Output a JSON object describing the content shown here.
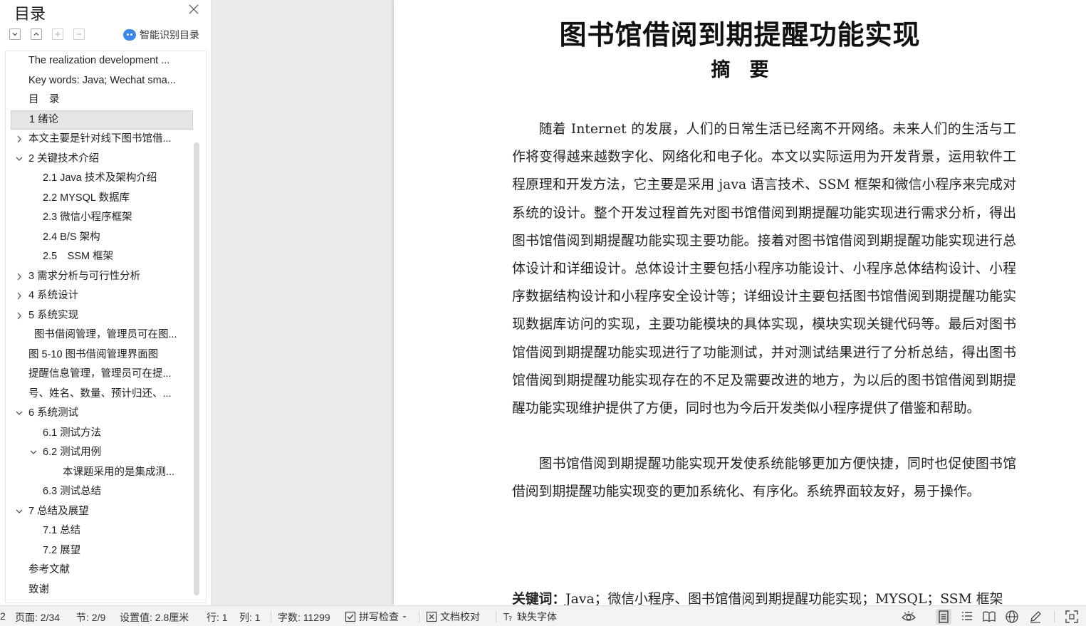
{
  "sidebar": {
    "title": "目录",
    "smart_toc_label": "智能识别目录",
    "items": [
      {
        "label": "The realization development ...",
        "level": 1,
        "chevron": "none"
      },
      {
        "label": "Key words: Java; Wechat sma...",
        "level": 1,
        "chevron": "none"
      },
      {
        "label": "目　录",
        "level": 1,
        "chevron": "none"
      },
      {
        "label": "1 绪论",
        "level": 1,
        "chevron": "none",
        "selected": true
      },
      {
        "label": "本文主要是针对线下图书馆借...",
        "level": 1,
        "chevron": "right"
      },
      {
        "label": "2  关键技术介绍",
        "level": 1,
        "chevron": "down"
      },
      {
        "label": "2.1 Java 技术及架构介绍",
        "level": 2,
        "chevron": "none"
      },
      {
        "label": "2.2 MYSQL 数据库",
        "level": 2,
        "chevron": "none"
      },
      {
        "label": "2.3 微信小程序框架",
        "level": 2,
        "chevron": "none"
      },
      {
        "label": "2.4 B/S 架构",
        "level": 2,
        "chevron": "none"
      },
      {
        "label": "2.5　SSM 框架",
        "level": 2,
        "chevron": "none"
      },
      {
        "label": "3  需求分析与可行性分析",
        "level": 1,
        "chevron": "right"
      },
      {
        "label": "4  系统设计",
        "level": 1,
        "chevron": "right"
      },
      {
        "label": "5 系统实现",
        "level": 1,
        "chevron": "right"
      },
      {
        "label": "图书借阅管理，管理员可在图...",
        "level": 1.3,
        "chevron": "none"
      },
      {
        "label": "图 5-10 图书借阅管理界面图",
        "level": 1,
        "chevron": "none"
      },
      {
        "label": "提醒信息管理，管理员可在提...",
        "level": 1,
        "chevron": "none"
      },
      {
        "label": "号、姓名、数量、预计归还、...",
        "level": 1,
        "chevron": "none"
      },
      {
        "label": "6  系统测试",
        "level": 1,
        "chevron": "down"
      },
      {
        "label": "6.1 测试方法",
        "level": 2,
        "chevron": "none"
      },
      {
        "label": "6.2 测试用例",
        "level": 2,
        "chevron": "down"
      },
      {
        "label": "本课题采用的是集成测...",
        "level": 3,
        "chevron": "none"
      },
      {
        "label": "6.3  测试总结",
        "level": 2,
        "chevron": "none"
      },
      {
        "label": "7 总结及展望",
        "level": 1,
        "chevron": "down"
      },
      {
        "label": "7.1  总结",
        "level": 2,
        "chevron": "none"
      },
      {
        "label": "7.2  展望",
        "level": 2,
        "chevron": "none"
      },
      {
        "label": "参考文献",
        "level": 1,
        "chevron": "none"
      },
      {
        "label": "致谢",
        "level": 1,
        "chevron": "none"
      }
    ]
  },
  "document": {
    "title": "图书馆借阅到期提醒功能实现",
    "subtitle": "摘　要",
    "paragraphs": [
      "随着 Internet 的发展，人们的日常生活已经离不开网络。未来人们的生活与工作将变得越来越数字化、网络化和电子化。本文以实际运用为开发背景，运用软件工程原理和开发方法，它主要是采用 java 语言技术、SSM 框架和微信小程序来完成对系统的设计。整个开发过程首先对图书馆借阅到期提醒功能实现进行需求分析，得出图书馆借阅到期提醒功能实现主要功能。接着对图书馆借阅到期提醒功能实现进行总体设计和详细设计。总体设计主要包括小程序功能设计、小程序总体结构设计、小程序数据结构设计和小程序安全设计等；详细设计主要包括图书馆借阅到期提醒功能实现数据库访问的实现，主要功能模块的具体实现，模块实现关键代码等。最后对图书馆借阅到期提醒功能实现进行了功能测试，并对测试结果进行了分析总结，得出图书馆借阅到期提醒功能实现存在的不足及需要改进的地方，为以后的图书馆借阅到期提醒功能实现维护提供了方便，同时也为今后开发类似小程序提供了借鉴和帮助。",
      "图书馆借阅到期提醒功能实现开发使系统能够更加方便快捷，同时也促使图书馆借阅到期提醒功能实现变的更加系统化、有序化。系统界面较友好，易于操作。"
    ],
    "keywords_label": "关键词：",
    "keywords": "Java；微信小程序、图书馆借阅到期提醒功能实现；MYSQL；SSM 框架"
  },
  "status": {
    "leading": "2",
    "page": "页面: 2/34",
    "section": "节: 2/9",
    "setting": "设置值: 2.8厘米",
    "row": "行: 1",
    "col": "列: 1",
    "words": "字数: 11299",
    "spellcheck": "拼写检查",
    "proofread": "文档校对",
    "missing_fonts": "缺失字体"
  }
}
